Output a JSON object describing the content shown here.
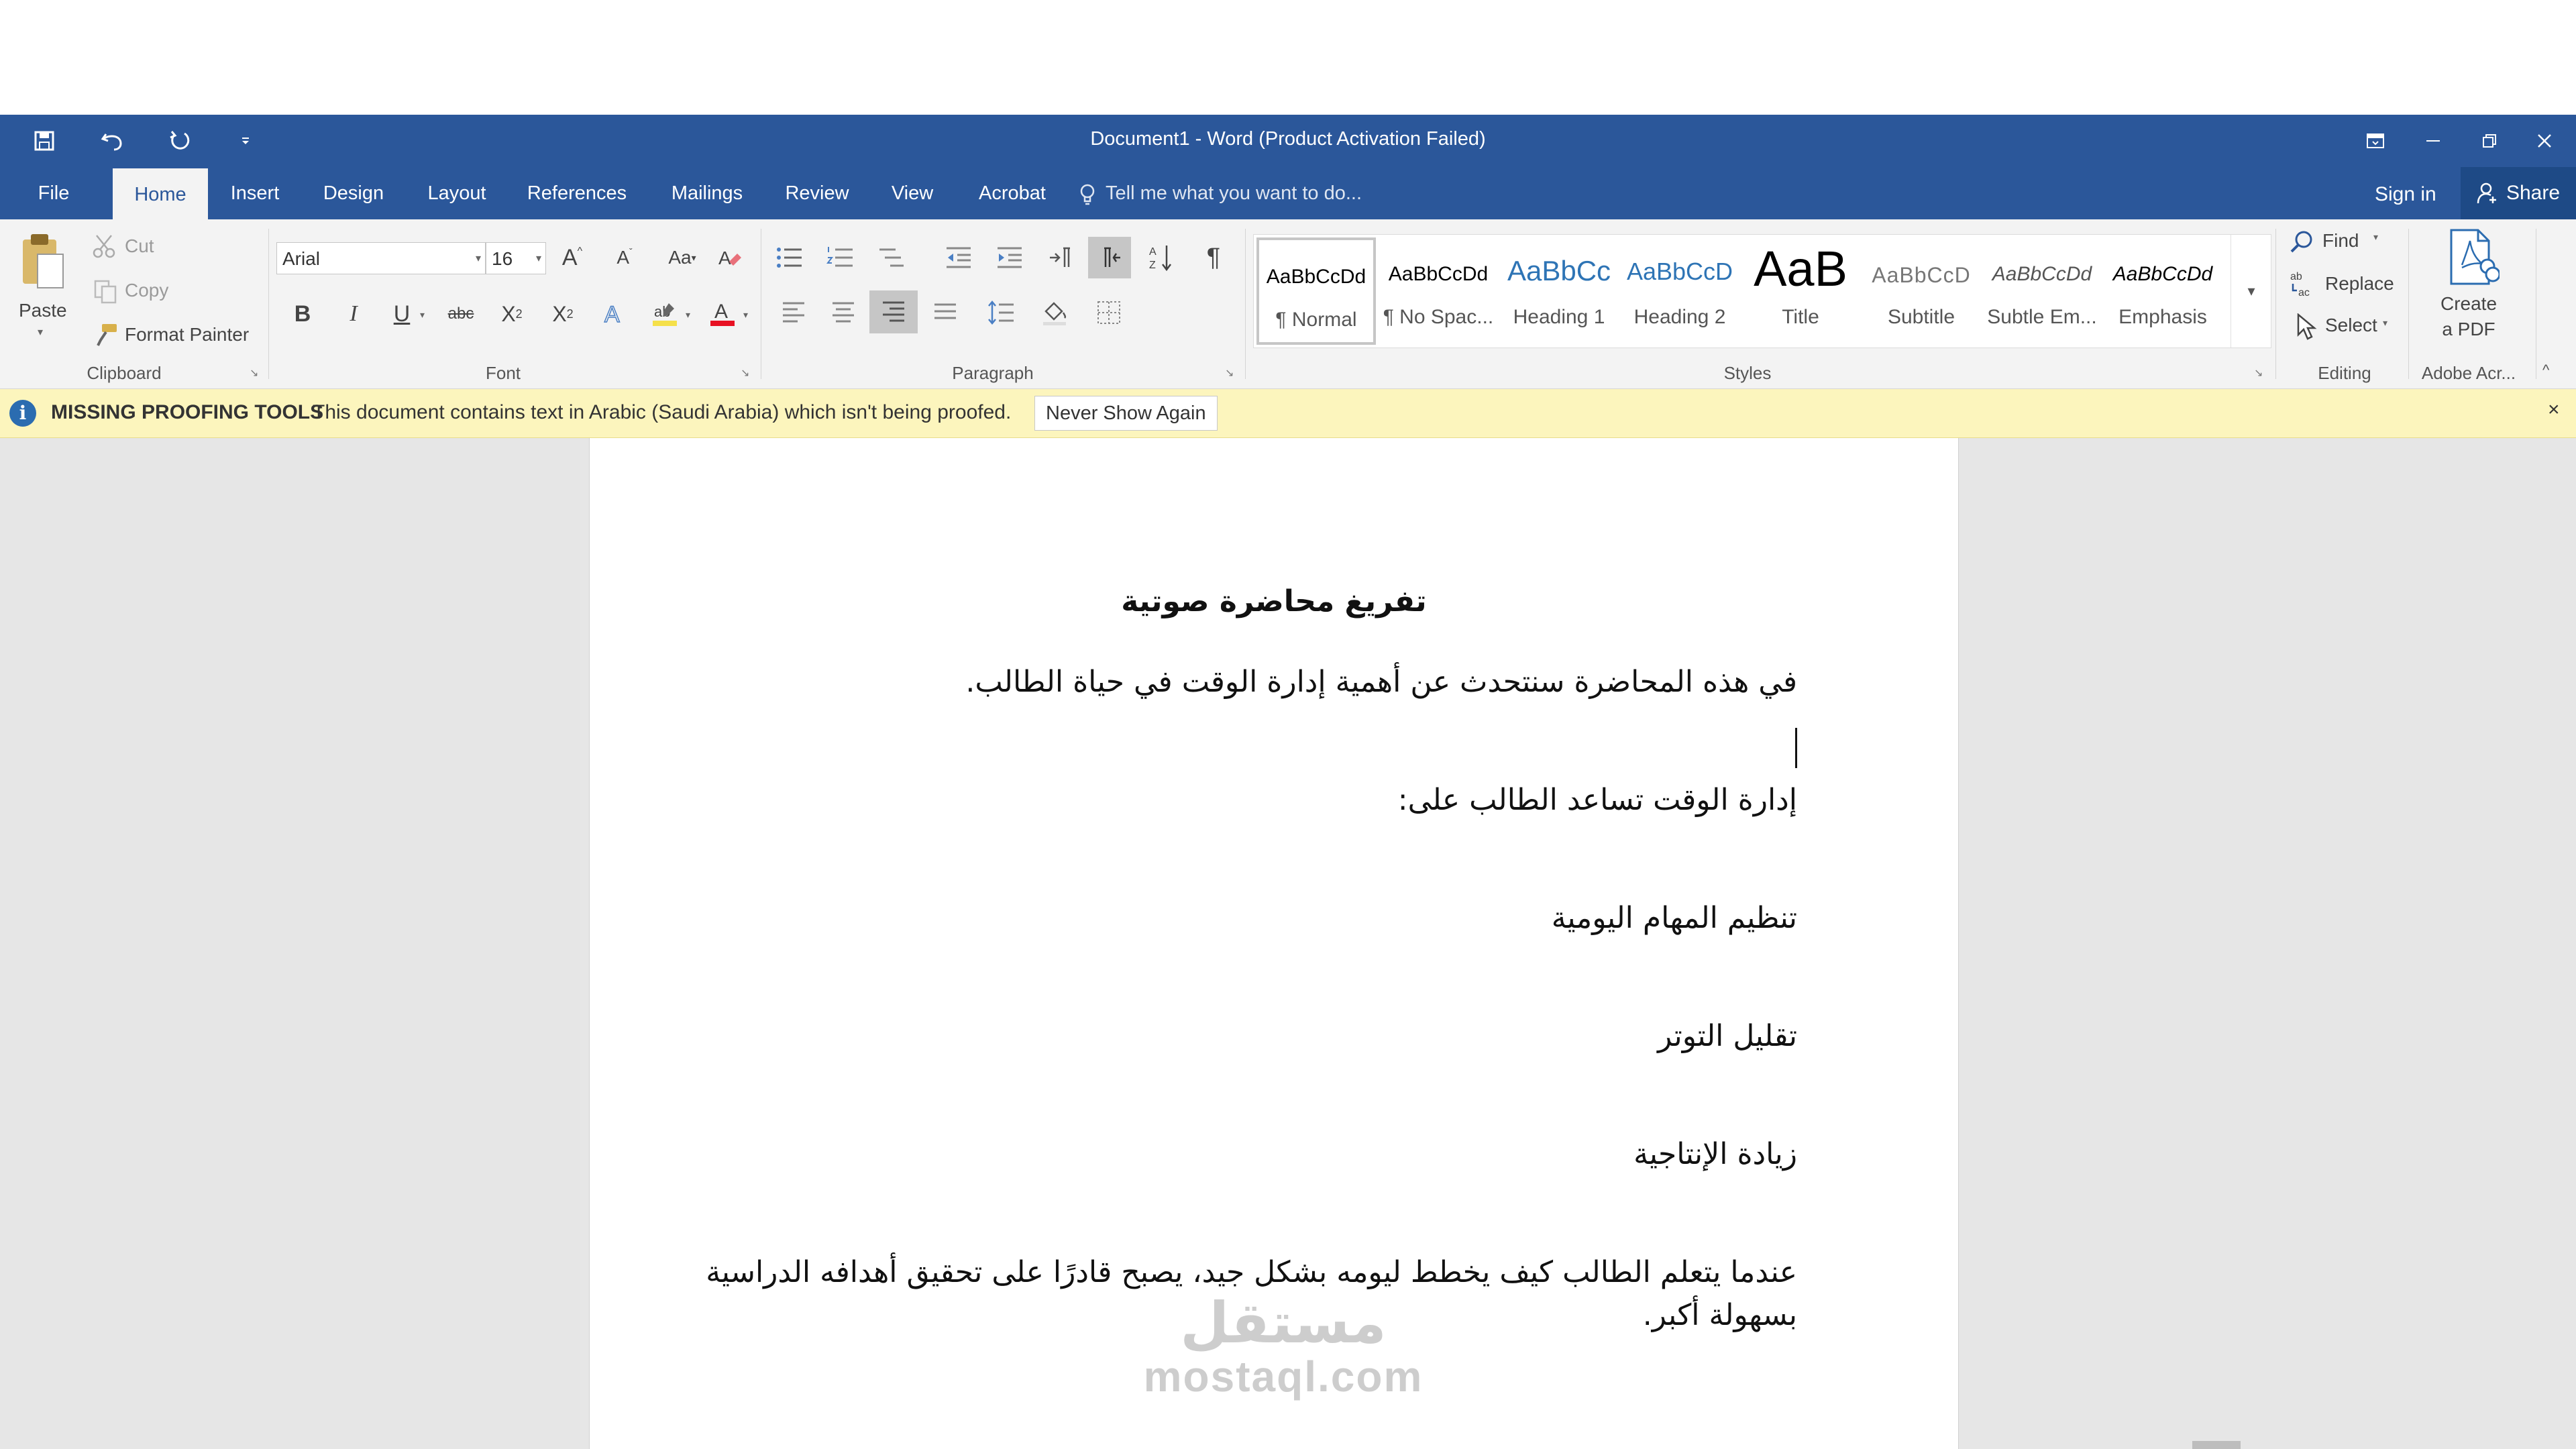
{
  "titlebar": {
    "title": "Document1 - Word (Product Activation Failed)",
    "qat": [
      "save-icon",
      "undo-icon",
      "redo-icon",
      "customize-qat-icon"
    ],
    "window_controls": [
      "ribbon-display-options-icon",
      "minimize-icon",
      "restore-icon",
      "close-icon"
    ]
  },
  "tabs": [
    "File",
    "Home",
    "Insert",
    "Design",
    "Layout",
    "References",
    "Mailings",
    "Review",
    "View",
    "Acrobat"
  ],
  "active_tab": "Home",
  "tellme_placeholder": "Tell me what you want to do...",
  "signin": "Sign in",
  "share": "Share",
  "ribbon": {
    "clipboard": {
      "paste": "Paste",
      "cut": "Cut",
      "copy": "Copy",
      "format_painter": "Format Painter",
      "label": "Clipboard"
    },
    "font": {
      "family": "Arial",
      "size": "16",
      "grow": "A",
      "shrink": "A",
      "change_case": "Aa",
      "bold": "B",
      "italic": "I",
      "underline": "U",
      "strikethrough": "abc",
      "subscript": "X",
      "superscript": "X",
      "font_color_accent": "#e81123",
      "highlight_accent": "#f5e04a",
      "label": "Font"
    },
    "paragraph": {
      "label": "Paragraph"
    },
    "styles": {
      "items": [
        {
          "sample": "AaBbCcDd",
          "name": "¶ Normal"
        },
        {
          "sample": "AaBbCcDd",
          "name": "¶ No Spac..."
        },
        {
          "sample": "AaBbCc",
          "name": "Heading 1"
        },
        {
          "sample": "AaBbCcD",
          "name": "Heading 2"
        },
        {
          "sample": "AaB",
          "name": "Title"
        },
        {
          "sample": "AaBbCcD",
          "name": "Subtitle"
        },
        {
          "sample": "AaBbCcDd",
          "name": "Subtle Em..."
        },
        {
          "sample": "AaBbCcDd",
          "name": "Emphasis"
        }
      ],
      "label": "Styles"
    },
    "editing": {
      "find": "Find",
      "replace": "Replace",
      "select": "Select",
      "label": "Editing"
    },
    "adobe": {
      "create_line1": "Create",
      "create_line2": "a PDF",
      "label": "Adobe Acr..."
    }
  },
  "infobar": {
    "title": "MISSING PROOFING TOOLS",
    "message": "This document contains text in Arabic (Saudi Arabia) which isn't being proofed.",
    "button": "Never Show Again",
    "close": "×"
  },
  "document": {
    "heading": "تفريغ محاضرة صوتية",
    "paragraphs": [
      "في هذه المحاضرة سنتحدث عن أهمية إدارة الوقت في حياة الطالب.",
      "إدارة الوقت تساعد الطالب على:",
      "تنظيم المهام اليومية",
      "تقليل التوتر",
      "زيادة الإنتاجية",
      "عندما يتعلم الطالب كيف يخطط ليومه بشكل جيد، يصبح قادرًا على تحقيق أهدافه الدراسية",
      "بسهولة أكبر."
    ]
  },
  "watermark": {
    "arabic": "مستقل",
    "latin": "mostaql.com"
  }
}
